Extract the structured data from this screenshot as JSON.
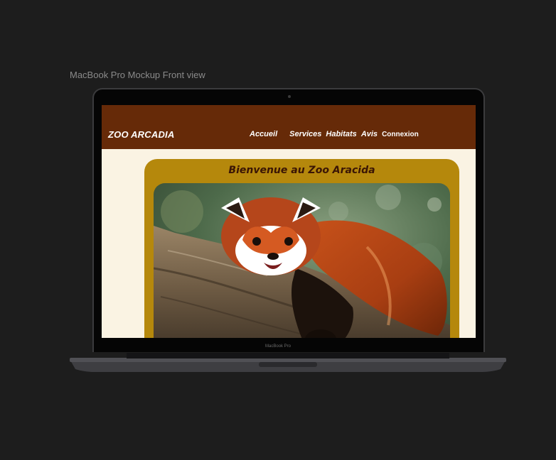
{
  "canvas_label": "MacBook Pro Mockup Front view",
  "device_brand": "MacBook Pro",
  "site": {
    "logo": "ZOO ARCADIA",
    "nav": [
      {
        "label": "Accueil"
      },
      {
        "label": "Services"
      },
      {
        "label": "Habitats"
      },
      {
        "label": "Avis"
      },
      {
        "label": "Connexion"
      }
    ],
    "hero_title": "Bienvenue au Zoo Aracida",
    "hero_image": "red-panda-on-branch"
  },
  "colors": {
    "page_bg": "#1d1d1d",
    "header_bg": "#662a08",
    "site_bg": "#faf3e3",
    "hero_bg": "#b5880c",
    "hero_title": "#3a1505"
  }
}
